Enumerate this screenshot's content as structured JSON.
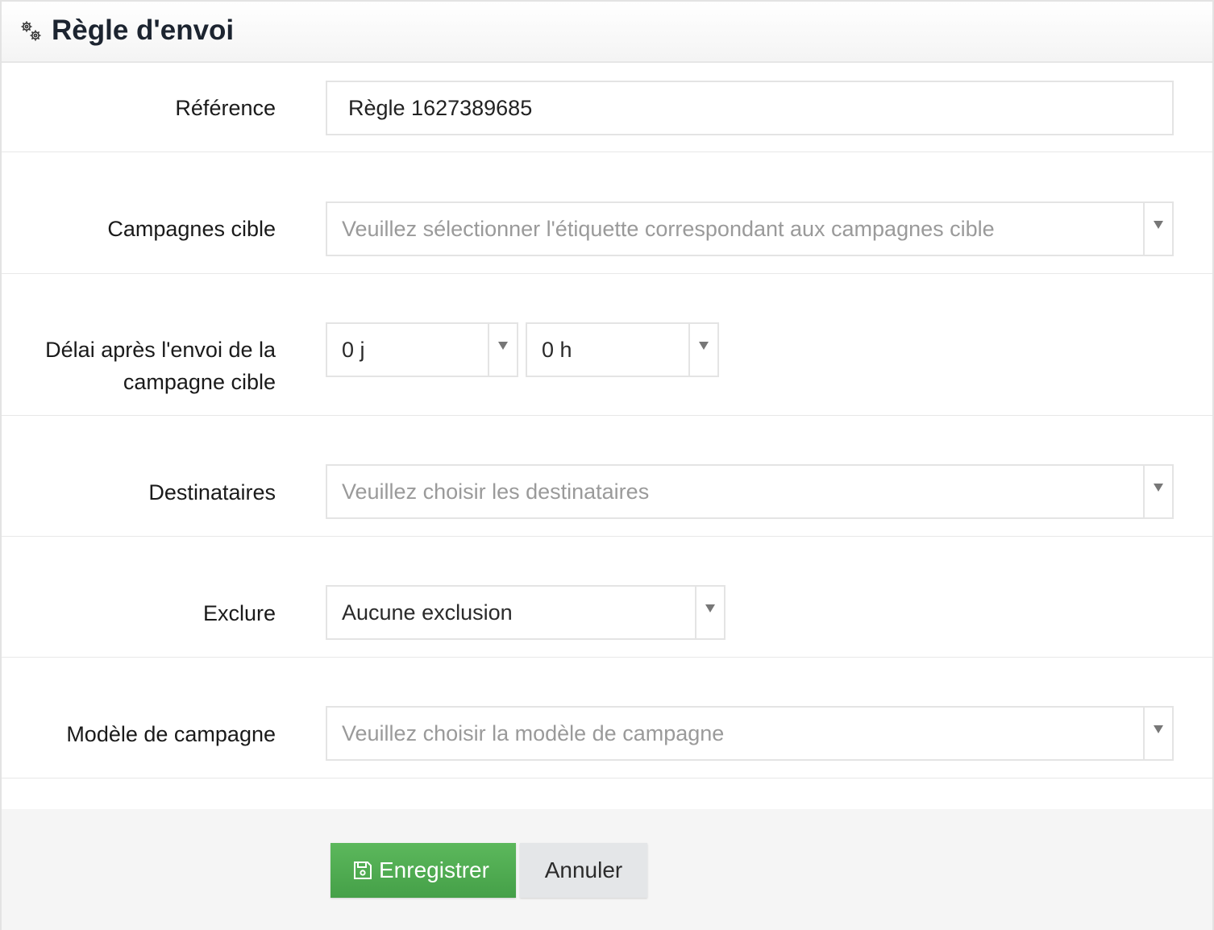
{
  "header": {
    "title": "Règle d'envoi",
    "icon": "gears-icon"
  },
  "form": {
    "reference": {
      "label": "Référence",
      "value": "Règle 1627389685"
    },
    "target_campaigns": {
      "label": "Campagnes cible",
      "placeholder": "Veuillez sélectionner l'étiquette correspondant aux campagnes cible"
    },
    "delay": {
      "label_line1": "Délai après l'envoi de la",
      "label_line2": "campagne cible",
      "days": "0 j",
      "hours": "0 h"
    },
    "recipients": {
      "label": "Destinataires",
      "placeholder": "Veuillez choisir les destinataires"
    },
    "exclude": {
      "label": "Exclure",
      "value": "Aucune exclusion"
    },
    "template": {
      "label": "Modèle de campagne",
      "placeholder": "Veuillez choisir la modèle de campagne"
    }
  },
  "actions": {
    "save_label": "Enregistrer",
    "cancel_label": "Annuler"
  },
  "colors": {
    "save_button": "#4cae4c",
    "cancel_button": "#e4e6e8",
    "footer_bg": "#f5f5f5"
  }
}
